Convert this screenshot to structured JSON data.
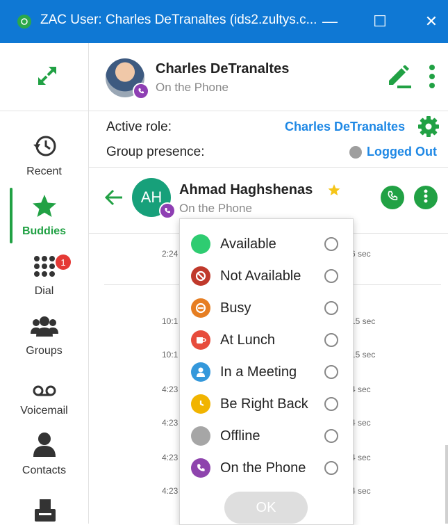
{
  "window": {
    "title": "ZAC User: Charles DeTranaltes (ids2.zultys.c...",
    "minimize_glyph": "—",
    "maximize_glyph": "☐",
    "close_glyph": "✕"
  },
  "user": {
    "name": "Charles DeTranaltes",
    "status": "On the Phone"
  },
  "role": {
    "active_role_label": "Active role:",
    "active_role_value": "Charles DeTranaltes",
    "group_presence_label": "Group presence:",
    "group_presence_value": "Logged Out"
  },
  "nav": {
    "items": [
      {
        "label": "Recent",
        "icon": "history-icon"
      },
      {
        "label": "Buddies",
        "icon": "star-icon",
        "active": true
      },
      {
        "label": "Dial",
        "icon": "dialpad-icon",
        "badge": "1"
      },
      {
        "label": "Groups",
        "icon": "groups-icon"
      },
      {
        "label": "Voicemail",
        "icon": "voicemail-icon"
      },
      {
        "label": "Contacts",
        "icon": "contacts-icon"
      },
      {
        "label": "",
        "icon": "fax-icon"
      }
    ]
  },
  "contact": {
    "initials": "AH",
    "name": "Ahmad Haghshenas",
    "status": "On the Phone"
  },
  "history": [
    {
      "time": "2:24",
      "duration": "6 sec"
    },
    {
      "time": "10:1",
      "duration": "15 sec"
    },
    {
      "time": "10:1",
      "duration": "15 sec"
    },
    {
      "time": "4:23",
      "duration": "4 sec"
    },
    {
      "time": "4:23",
      "duration": "4 sec"
    },
    {
      "time": "4:23",
      "duration": "4 sec"
    },
    {
      "time": "4:23",
      "duration": "4 sec"
    }
  ],
  "presence_menu": {
    "options": [
      {
        "label": "Available",
        "color": "#2ecc71",
        "icon": "available-icon"
      },
      {
        "label": "Not Available",
        "color": "#c0392b",
        "icon": "not-available-icon"
      },
      {
        "label": "Busy",
        "color": "#e67e22",
        "icon": "busy-icon"
      },
      {
        "label": "At Lunch",
        "color": "#e74c3c",
        "icon": "lunch-cup-icon"
      },
      {
        "label": "In a Meeting",
        "color": "#3498db",
        "icon": "meeting-person-icon"
      },
      {
        "label": "Be Right Back",
        "color": "#f1b400",
        "icon": "clock-icon"
      },
      {
        "label": "Offline",
        "color": "#a6a6a6",
        "icon": "offline-icon"
      },
      {
        "label": "On the Phone",
        "color": "#8e44ad",
        "icon": "phone-icon"
      }
    ],
    "ok_label": "OK"
  },
  "colors": {
    "titlebar": "#0f78d4",
    "accent_green": "#21a144",
    "link_blue": "#1e88e5"
  }
}
